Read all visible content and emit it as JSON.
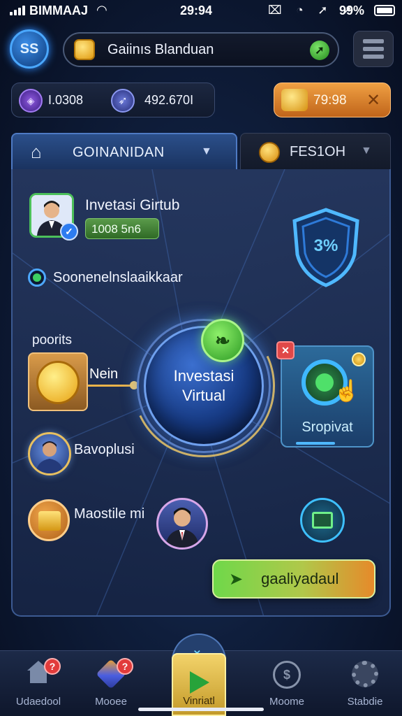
{
  "status_bar": {
    "carrier": "BIMMAAJ",
    "time": "29:94",
    "battery": "99%",
    "system_icons": "⌧ ◔ ➚ ➚"
  },
  "header": {
    "logo_text": "SS",
    "search_text": "Gaiinıs Blanduan"
  },
  "stats": {
    "stat1_value": "I.0308",
    "stat2_value": "492.670I",
    "timer_value": "79:98",
    "timer_close": "✕"
  },
  "tabs": {
    "main_label": "GOINANIDAN",
    "side_label": "FES1OH"
  },
  "profile": {
    "name": "Invetasi Girtub",
    "score": "1008 5n6"
  },
  "shield": {
    "text": "3%"
  },
  "radio": {
    "label": "Soonenelnslaaikkaar"
  },
  "points": {
    "heading": "poorits",
    "side_label": "Nein"
  },
  "orb": {
    "title": "Investasi Virtual"
  },
  "spin": {
    "label": "Sropivat"
  },
  "bonus": {
    "label": "Bavoplusi"
  },
  "gold": {
    "label": "Maostile mi"
  },
  "cta": {
    "label": "gaaliyadaul"
  },
  "bottom_nav": {
    "items": [
      {
        "label": "Udaedool",
        "badge": "?"
      },
      {
        "label": "Mooee",
        "badge": "?"
      },
      {
        "label": "Vinriatl"
      },
      {
        "label": "Moome"
      },
      {
        "label": "Stabdie"
      }
    ]
  },
  "colors": {
    "accent_blue": "#4aa8ff",
    "accent_green": "#3ccf62",
    "accent_gold": "#e8b84a",
    "alert_red": "#e23b3b"
  },
  "icons": [
    "signal-icon",
    "wifi-icon",
    "battery-icon",
    "coin-icon",
    "menu-icon",
    "home-icon",
    "chevron-down-icon",
    "shield-icon",
    "verified-icon",
    "close-icon",
    "hand-icon",
    "mail-icon",
    "play-icon",
    "gear-icon"
  ]
}
